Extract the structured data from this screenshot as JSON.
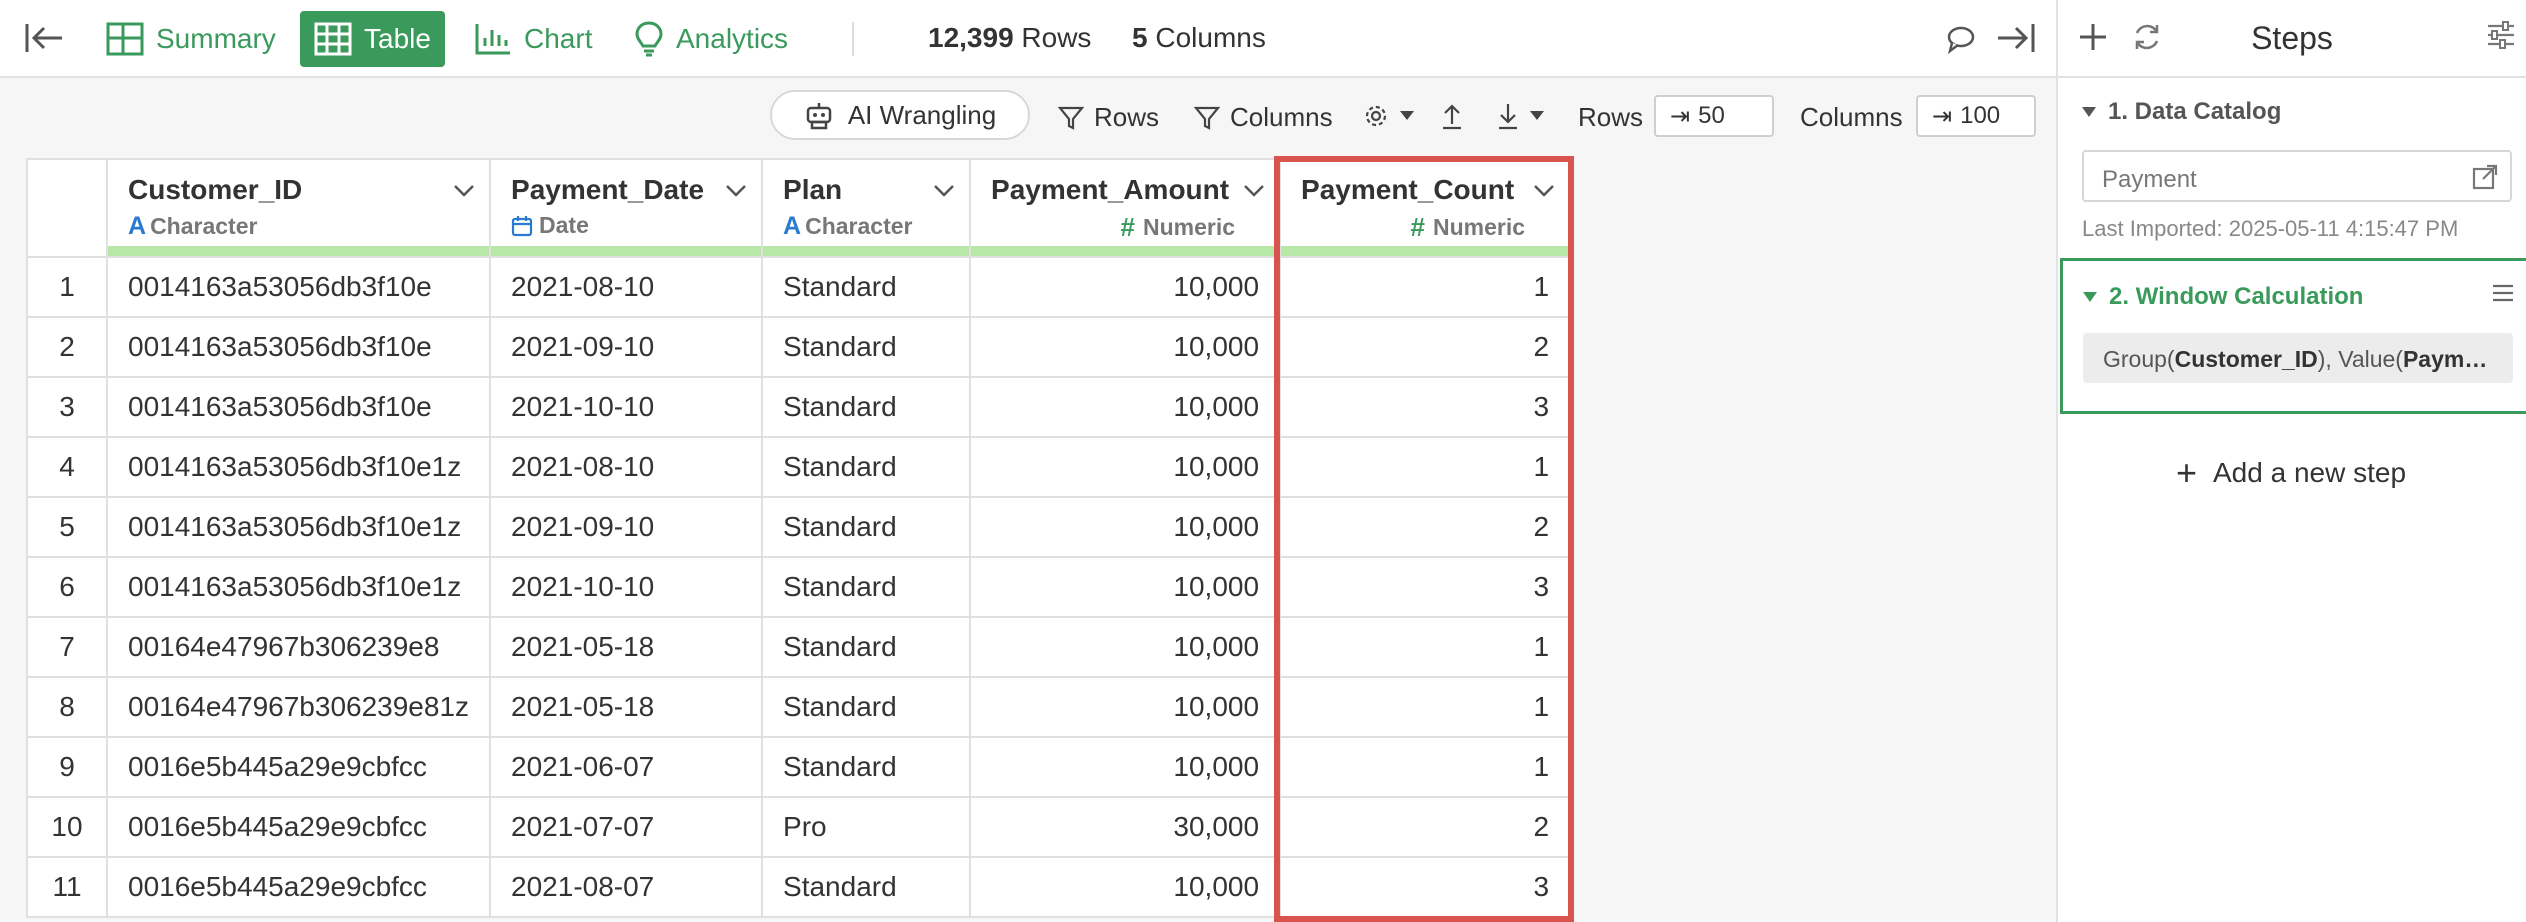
{
  "topbar": {
    "nav": [
      {
        "label": "Summary",
        "icon": "summary-icon",
        "active": false
      },
      {
        "label": "Table",
        "icon": "table-icon",
        "active": true
      },
      {
        "label": "Chart",
        "icon": "chart-icon",
        "active": false
      },
      {
        "label": "Analytics",
        "icon": "lightbulb-icon",
        "active": false
      }
    ],
    "rows_count": "12,399",
    "rows_label": "Rows",
    "columns_count": "5",
    "columns_label": "Columns"
  },
  "toolbar": {
    "ai_wrangling": "AI Wrangling",
    "rows_filter": "Rows",
    "columns_filter": "Columns",
    "rows_label": "Rows",
    "rows_value": "50",
    "columns_label": "Columns",
    "columns_value": "100"
  },
  "table": {
    "columns": [
      {
        "name": "Customer_ID",
        "type": "Character"
      },
      {
        "name": "Payment_Date",
        "type": "Date"
      },
      {
        "name": "Plan",
        "type": "Character"
      },
      {
        "name": "Payment_Amount",
        "type": "Numeric"
      },
      {
        "name": "Payment_Count",
        "type": "Numeric"
      }
    ],
    "rows": [
      [
        "1",
        "0014163a53056db3f10e",
        "2021-08-10",
        "Standard",
        "10,000",
        "1"
      ],
      [
        "2",
        "0014163a53056db3f10e",
        "2021-09-10",
        "Standard",
        "10,000",
        "2"
      ],
      [
        "3",
        "0014163a53056db3f10e",
        "2021-10-10",
        "Standard",
        "10,000",
        "3"
      ],
      [
        "4",
        "0014163a53056db3f10e1z",
        "2021-08-10",
        "Standard",
        "10,000",
        "1"
      ],
      [
        "5",
        "0014163a53056db3f10e1z",
        "2021-09-10",
        "Standard",
        "10,000",
        "2"
      ],
      [
        "6",
        "0014163a53056db3f10e1z",
        "2021-10-10",
        "Standard",
        "10,000",
        "3"
      ],
      [
        "7",
        "00164e47967b306239e8",
        "2021-05-18",
        "Standard",
        "10,000",
        "1"
      ],
      [
        "8",
        "00164e47967b306239e81z",
        "2021-05-18",
        "Standard",
        "10,000",
        "1"
      ],
      [
        "9",
        "0016e5b445a29e9cbfcc",
        "2021-06-07",
        "Standard",
        "10,000",
        "1"
      ],
      [
        "10",
        "0016e5b445a29e9cbfcc",
        "2021-07-07",
        "Pro",
        "30,000",
        "2"
      ],
      [
        "11",
        "0016e5b445a29e9cbfcc",
        "2021-08-07",
        "Standard",
        "10,000",
        "3"
      ]
    ]
  },
  "steps": {
    "title": "Steps",
    "step1": {
      "title": "1. Data Catalog",
      "dataset": "Payment",
      "last_imported": "Last Imported: 2025-05-11 4:15:47 PM"
    },
    "step2": {
      "title": "2. Window Calculation",
      "formula_parts": {
        "p1": "Group(",
        "b1": "Customer_ID",
        "p2": "), Value(",
        "b2": "Paym…"
      }
    },
    "add_step": "Add a new step"
  },
  "colors": {
    "accent": "#3a9a5b",
    "highlight": "#d9534f",
    "header_bar": "#b8e8a8"
  }
}
